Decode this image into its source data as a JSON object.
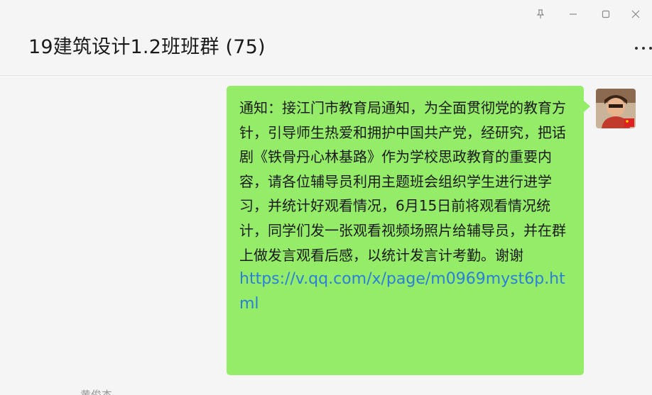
{
  "window": {
    "controls": {
      "pin_icon": "pin-icon",
      "minimize_icon": "minimize-icon",
      "maximize_icon": "maximize-icon",
      "close_icon": "close-icon"
    }
  },
  "header": {
    "title": "19建筑设计1.2班班群 (75)",
    "more_icon": "more-dots-icon"
  },
  "message": {
    "text": "通知：接江门市教育局通知，为全面贯彻党的教育方针，引导师生热爱和拥护中国共产党，经研究，把话剧《铁骨丹心林基路》作为学校思政教育的重要内容，请各位辅导员利用主题班会组织学生进行进学习，并统计好观看情况，6月15日前将观看情况统计，同学们发一张观看视频场照片给辅导员，并在群上做发言观看后感，以统计发言计考勤。谢谢",
    "link": "https://v.qq.com/x/page/m0969myst6p.html",
    "bubble_color": "#95ec69",
    "link_color": "#2a7fd6"
  },
  "next_sender": {
    "name": "黄俊杰"
  }
}
